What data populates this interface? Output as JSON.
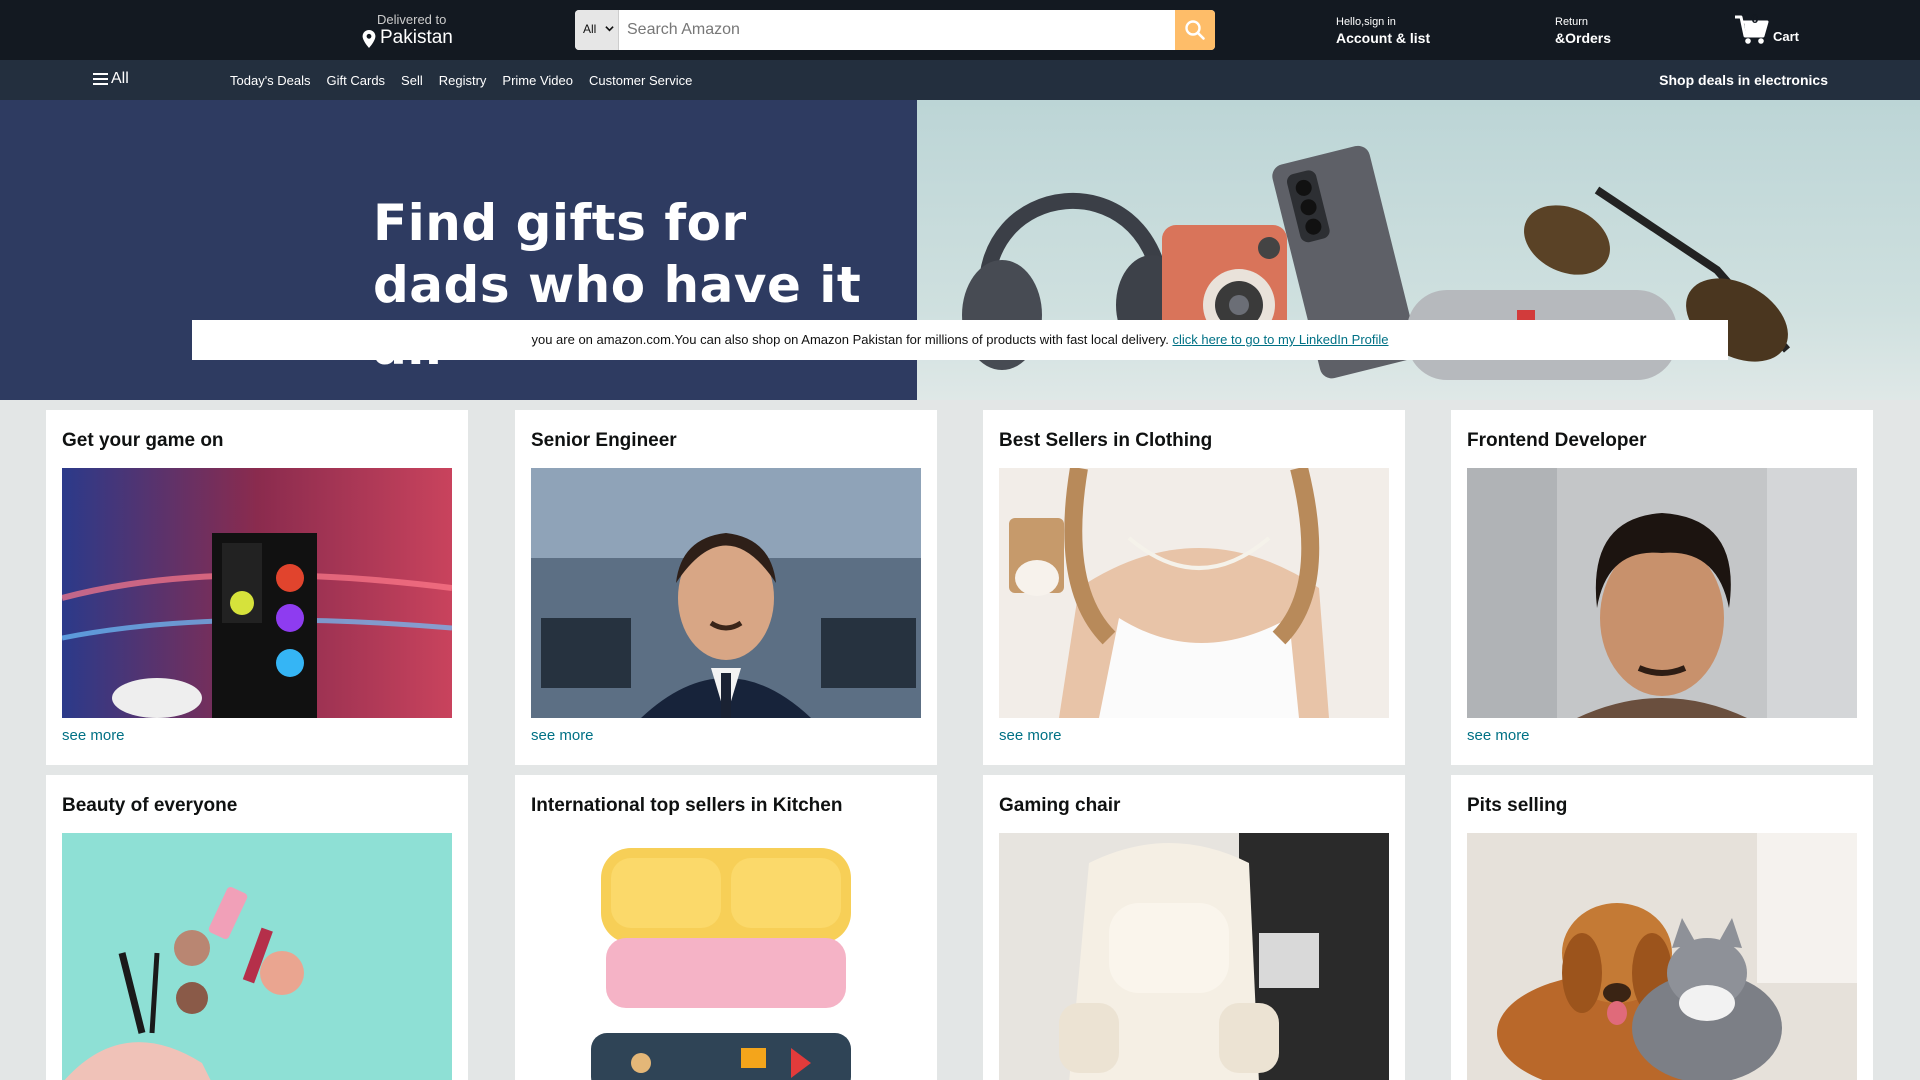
{
  "topnav": {
    "deliver_small": "Delivered to",
    "deliver_big": "Pakistan",
    "search_category": "All",
    "search_placeholder": "Search Amazon",
    "account_small": "Hello,sign in",
    "account_big": "Account & list",
    "returns_small": "Return",
    "returns_big": "&Orders",
    "cart_count": "0",
    "cart_label": "Cart"
  },
  "subnav": {
    "all_label": "All",
    "links": [
      "Today's Deals",
      "Gift Cards",
      "Sell",
      "Registry",
      "Prime Video",
      "Customer Service"
    ],
    "promo": "Shop deals in electronics"
  },
  "hero": {
    "title_line1": "Find gifts for",
    "title_line2": "dads who have it all",
    "notice_text": "you are on amazon.com.You can also shop on Amazon Pakistan for millions of products with fast local delivery.",
    "notice_link": "click here to go to my LinkedIn Profile"
  },
  "cards": [
    {
      "title": "Get your game on",
      "link": "see more",
      "image": "gaming-pc-image"
    },
    {
      "title": "Senior Engineer",
      "link": "see more",
      "image": "engineer-portrait-image"
    },
    {
      "title": "Best Sellers in Clothing",
      "link": "see more",
      "image": "clothing-image"
    },
    {
      "title": "Frontend Developer",
      "link": "see more",
      "image": "developer-portrait-image"
    },
    {
      "title": "Beauty of everyone",
      "image": "beauty-products-image"
    },
    {
      "title": "International top sellers in Kitchen",
      "image": "lunchbox-image"
    },
    {
      "title": "Gaming chair",
      "image": "gaming-chair-image"
    },
    {
      "title": "Pits selling",
      "image": "pets-image"
    }
  ],
  "colors": {
    "nav_bg": "#131921",
    "subnav_bg": "#232f3e",
    "search_button": "#febd69",
    "link": "#007185",
    "hero_left": "#2e3b61",
    "page_bg": "#e3e6e6"
  }
}
